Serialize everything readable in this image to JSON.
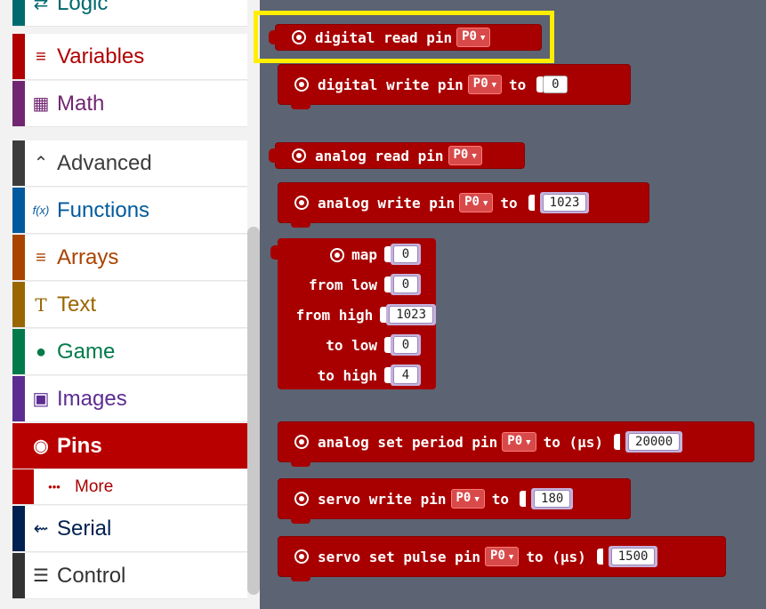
{
  "toolbox": {
    "categories": [
      {
        "label": "Logic",
        "icon": "logic-icon",
        "glyph": "⇄",
        "color": "#006970"
      },
      {
        "label": "Variables",
        "icon": "variables-icon",
        "glyph": "≡",
        "color": "#b00000"
      },
      {
        "label": "Math",
        "icon": "math-icon",
        "glyph": "▦",
        "color": "#712672"
      },
      {
        "label": "Advanced",
        "icon": "chevron-up-icon",
        "glyph": "⌃",
        "color": "#3c3c3c"
      },
      {
        "label": "Functions",
        "icon": "functions-icon",
        "glyph": "f(x)",
        "color": "#005a9e"
      },
      {
        "label": "Arrays",
        "icon": "arrays-icon",
        "glyph": "≡",
        "color": "#a94400"
      },
      {
        "label": "Text",
        "icon": "text-icon",
        "glyph": "T",
        "color": "#996600"
      },
      {
        "label": "Game",
        "icon": "gamepad-icon",
        "glyph": "●",
        "color": "#007a4b"
      },
      {
        "label": "Images",
        "icon": "image-icon",
        "glyph": "▣",
        "color": "#5c2d91"
      },
      {
        "label": "Pins",
        "icon": "pin-icon",
        "glyph": "◉",
        "color": "#b80000"
      },
      {
        "label": "More",
        "icon": "more-icon",
        "glyph": "•••",
        "color": "#b80000"
      },
      {
        "label": "Serial",
        "icon": "usb-icon",
        "glyph": "⇜",
        "color": "#002050"
      },
      {
        "label": "Control",
        "icon": "control-icon",
        "glyph": "☰",
        "color": "#333333"
      }
    ]
  },
  "blocks": {
    "digital_read": {
      "text": "digital read pin",
      "pin": "P0"
    },
    "digital_write": {
      "text": "digital write pin",
      "pin": "P0",
      "to": "to",
      "value": "0"
    },
    "analog_read": {
      "text": "analog read pin",
      "pin": "P0"
    },
    "analog_write": {
      "text": "analog write pin",
      "pin": "P0",
      "to": "to",
      "value": "1023"
    },
    "map": {
      "title": "map",
      "rows": [
        {
          "label": "map",
          "value": "0"
        },
        {
          "label": "from low",
          "value": "0"
        },
        {
          "label": "from high",
          "value": "1023"
        },
        {
          "label": "to low",
          "value": "0"
        },
        {
          "label": "to high",
          "value": "4"
        }
      ]
    },
    "analog_set_period": {
      "text": "analog set period pin",
      "pin": "P0",
      "to": "to (µs)",
      "value": "20000"
    },
    "servo_write": {
      "text": "servo write pin",
      "pin": "P0",
      "to": "to",
      "value": "180"
    },
    "servo_set_pulse": {
      "text": "servo set pulse pin",
      "pin": "P0",
      "to": "to (µs)",
      "value": "1500"
    }
  },
  "highlight_color": "#ffee00",
  "block_color": "#a80000"
}
